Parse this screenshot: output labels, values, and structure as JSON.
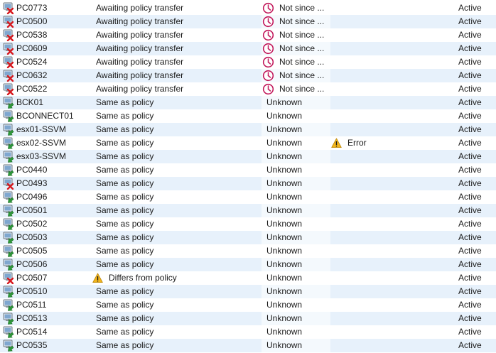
{
  "colors": {
    "row_alt": "#e7f1fb",
    "pending_clock": "#c2185b",
    "warning": "#f2b51c",
    "error_x": "#d7181e",
    "ok_arrow": "#2e9a3a"
  },
  "rows": [
    {
      "name": "PC0773",
      "icon": "computer-error-icon",
      "policy": "Awaiting policy transfer",
      "status": "Not since ...",
      "status_icon": "clock-icon",
      "error": "",
      "state": "Active"
    },
    {
      "name": "PC0500",
      "icon": "computer-error-icon",
      "policy": "Awaiting policy transfer",
      "status": "Not since ...",
      "status_icon": "clock-icon",
      "error": "",
      "state": "Active"
    },
    {
      "name": "PC0538",
      "icon": "computer-error-icon",
      "policy": "Awaiting policy transfer",
      "status": "Not since ...",
      "status_icon": "clock-icon",
      "error": "",
      "state": "Active"
    },
    {
      "name": "PC0609",
      "icon": "computer-error-icon",
      "policy": "Awaiting policy transfer",
      "status": "Not since ...",
      "status_icon": "clock-icon",
      "error": "",
      "state": "Active"
    },
    {
      "name": "PC0524",
      "icon": "computer-error-icon",
      "policy": "Awaiting policy transfer",
      "status": "Not since ...",
      "status_icon": "clock-icon",
      "error": "",
      "state": "Active"
    },
    {
      "name": "PC0632",
      "icon": "computer-error-icon",
      "policy": "Awaiting policy transfer",
      "status": "Not since ...",
      "status_icon": "clock-icon",
      "error": "",
      "state": "Active"
    },
    {
      "name": "PC0522",
      "icon": "computer-error-icon",
      "policy": "Awaiting policy transfer",
      "status": "Not since ...",
      "status_icon": "clock-icon",
      "error": "",
      "state": "Active"
    },
    {
      "name": "BCK01",
      "icon": "computer-ok-icon",
      "policy": "Same as policy",
      "status": "Unknown",
      "error": "",
      "state": "Active"
    },
    {
      "name": "BCONNECT01",
      "icon": "computer-ok-icon",
      "policy": "Same as policy",
      "status": "Unknown",
      "error": "",
      "state": "Active"
    },
    {
      "name": "esx01-SSVM",
      "icon": "computer-ok-icon",
      "policy": "Same as policy",
      "status": "Unknown",
      "error": "",
      "state": "Active"
    },
    {
      "name": "esx02-SSVM",
      "icon": "computer-ok-icon",
      "policy": "Same as policy",
      "status": "Unknown",
      "error": "Error",
      "state": "Active"
    },
    {
      "name": "esx03-SSVM",
      "icon": "computer-ok-icon",
      "policy": "Same as policy",
      "status": "Unknown",
      "error": "",
      "state": "Active"
    },
    {
      "name": "PC0440",
      "icon": "computer-ok-icon",
      "policy": "Same as policy",
      "status": "Unknown",
      "error": "",
      "state": "Active"
    },
    {
      "name": "PC0493",
      "icon": "computer-error-icon",
      "policy": "Same as policy",
      "status": "Unknown",
      "error": "",
      "state": "Active"
    },
    {
      "name": "PC0496",
      "icon": "computer-ok-icon",
      "policy": "Same as policy",
      "status": "Unknown",
      "error": "",
      "state": "Active"
    },
    {
      "name": "PC0501",
      "icon": "computer-ok-icon",
      "policy": "Same as policy",
      "status": "Unknown",
      "error": "",
      "state": "Active"
    },
    {
      "name": "PC0502",
      "icon": "computer-ok-icon",
      "policy": "Same as policy",
      "status": "Unknown",
      "error": "",
      "state": "Active"
    },
    {
      "name": "PC0503",
      "icon": "computer-ok-icon",
      "policy": "Same as policy",
      "status": "Unknown",
      "error": "",
      "state": "Active"
    },
    {
      "name": "PC0505",
      "icon": "computer-ok-icon",
      "policy": "Same as policy",
      "status": "Unknown",
      "error": "",
      "state": "Active"
    },
    {
      "name": "PC0506",
      "icon": "computer-ok-icon",
      "policy": "Same as policy",
      "status": "Unknown",
      "error": "",
      "state": "Active"
    },
    {
      "name": "PC0507",
      "icon": "computer-error-icon",
      "policy": "Differs from policy",
      "policy_icon": "warning-icon",
      "status": "Unknown",
      "error": "",
      "state": "Active"
    },
    {
      "name": "PC0510",
      "icon": "computer-ok-icon",
      "policy": "Same as policy",
      "status": "Unknown",
      "error": "",
      "state": "Active"
    },
    {
      "name": "PC0511",
      "icon": "computer-ok-icon",
      "policy": "Same as policy",
      "status": "Unknown",
      "error": "",
      "state": "Active"
    },
    {
      "name": "PC0513",
      "icon": "computer-ok-icon",
      "policy": "Same as policy",
      "status": "Unknown",
      "error": "",
      "state": "Active"
    },
    {
      "name": "PC0514",
      "icon": "computer-ok-icon",
      "policy": "Same as policy",
      "status": "Unknown",
      "error": "",
      "state": "Active"
    },
    {
      "name": "PC0535",
      "icon": "computer-ok-icon",
      "policy": "Same as policy",
      "status": "Unknown",
      "error": "",
      "state": "Active"
    }
  ]
}
